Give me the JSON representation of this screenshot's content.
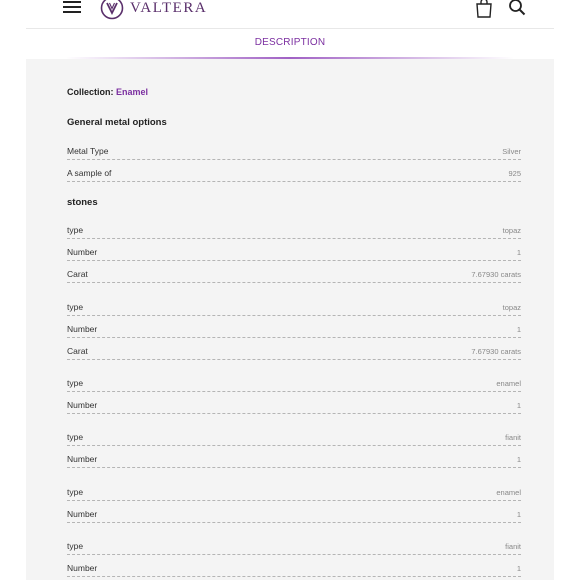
{
  "header": {
    "brand_name": "VALTERA",
    "icons": [
      "menu-icon",
      "valtera-logo-icon",
      "shopping-bag-icon",
      "search-icon"
    ]
  },
  "tabs": {
    "active_label": "DESCRIPTION"
  },
  "collection": {
    "label": "Collection:",
    "value": "Enamel"
  },
  "general_metal": {
    "title": "General metal options",
    "rows": [
      {
        "label": "Metal Type",
        "value": "Silver"
      },
      {
        "label": "A sample of",
        "value": "925"
      }
    ]
  },
  "stones": {
    "title": "stones",
    "groups": [
      [
        {
          "label": "type",
          "value": "topaz"
        },
        {
          "label": "Number",
          "value": "1"
        },
        {
          "label": "Carat",
          "value": "7.67930 carats"
        }
      ],
      [
        {
          "label": "type",
          "value": "topaz"
        },
        {
          "label": "Number",
          "value": "1"
        },
        {
          "label": "Carat",
          "value": "7.67930 carats"
        }
      ],
      [
        {
          "label": "type",
          "value": "enamel"
        },
        {
          "label": "Number",
          "value": "1"
        }
      ],
      [
        {
          "label": "type",
          "value": "fianit"
        },
        {
          "label": "Number",
          "value": "1"
        }
      ],
      [
        {
          "label": "type",
          "value": "enamel"
        },
        {
          "label": "Number",
          "value": "1"
        }
      ],
      [
        {
          "label": "type",
          "value": "fianit"
        },
        {
          "label": "Number",
          "value": "1"
        }
      ]
    ]
  },
  "colors": {
    "accent": "#7b2fa0",
    "brand": "#5a2f6b",
    "panel_bg": "#f4f4f4"
  }
}
